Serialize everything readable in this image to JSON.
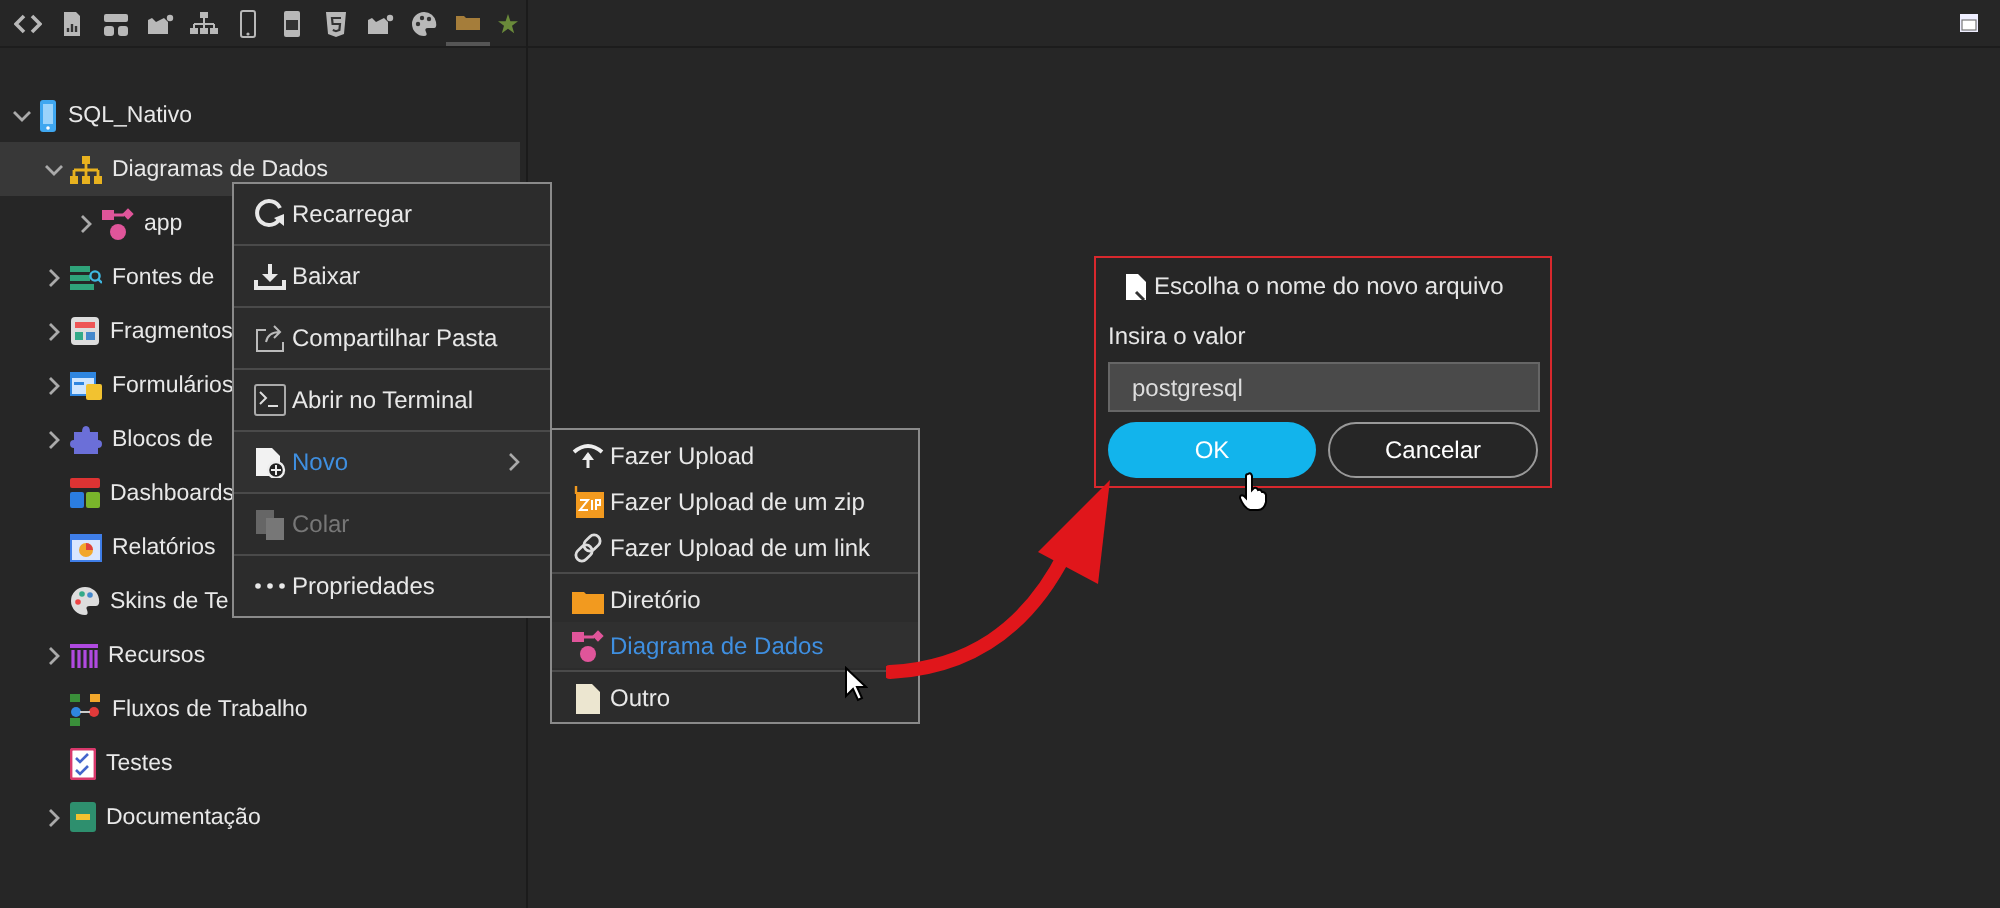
{
  "toolbar": [
    {
      "selected": false
    },
    {
      "selected": false
    },
    {
      "selected": false
    },
    {
      "selected": false
    },
    {
      "selected": false
    },
    {
      "selected": false
    },
    {
      "selected": false
    },
    {
      "selected": false
    },
    {
      "selected": false
    },
    {
      "selected": false
    },
    {
      "selected": true
    }
  ],
  "tree": [
    {
      "label": "SQL_Nativo",
      "expanded": true,
      "selected": false,
      "children": [
        {
          "label": "Diagramas de Dados",
          "expanded": true,
          "selected": true,
          "children": [
            {
              "label": "app",
              "expanded": false,
              "selected": false
            }
          ]
        },
        {
          "label": "Fontes de",
          "expanded": false,
          "selected": false
        },
        {
          "label": "Fragmentos",
          "expanded": false,
          "selected": false
        },
        {
          "label": "Formulários",
          "expanded": false,
          "selected": false
        },
        {
          "label": "Blocos de",
          "expanded": false,
          "selected": false
        },
        {
          "label": "Dashboards",
          "selected": false
        },
        {
          "label": "Relatórios",
          "selected": false
        },
        {
          "label": "Skins de Te",
          "selected": false
        },
        {
          "label": "Recursos",
          "expanded": false,
          "selected": false
        },
        {
          "label": "Fluxos de Trabalho",
          "selected": false
        },
        {
          "label": "Testes",
          "selected": false
        },
        {
          "label": "Documentação",
          "expanded": false,
          "selected": false
        }
      ]
    }
  ],
  "context_menu": [
    {
      "label": "Recarregar",
      "highlighted": false,
      "disabled": false
    },
    {
      "label": "Baixar",
      "highlighted": false,
      "disabled": false
    },
    {
      "label": "Compartilhar Pasta",
      "highlighted": false,
      "disabled": false
    },
    {
      "label": "Abrir no Terminal",
      "highlighted": false,
      "disabled": false
    },
    {
      "label": "Novo",
      "highlighted": true,
      "disabled": false,
      "submenu": true
    },
    {
      "label": "Colar",
      "highlighted": false,
      "disabled": true
    },
    {
      "label": "Propriedades",
      "highlighted": false,
      "disabled": false
    }
  ],
  "submenu": [
    [
      {
        "label": "Fazer Upload",
        "highlighted": false
      },
      {
        "label": "Fazer Upload de um zip",
        "highlighted": false
      },
      {
        "label": "Fazer Upload de um link",
        "highlighted": false
      }
    ],
    [
      {
        "label": "Diretório",
        "highlighted": false
      },
      {
        "label": "Diagrama de Dados",
        "highlighted": true
      }
    ],
    [
      {
        "label": "Outro",
        "highlighted": false
      }
    ]
  ],
  "dialog": {
    "title": "Escolha o nome do novo arquivo",
    "label": "Insira o valor",
    "value": "postgresql",
    "buttons": [
      {
        "label": "OK",
        "kind": "primary"
      },
      {
        "label": "Cancelar",
        "kind": "secondary"
      }
    ]
  }
}
